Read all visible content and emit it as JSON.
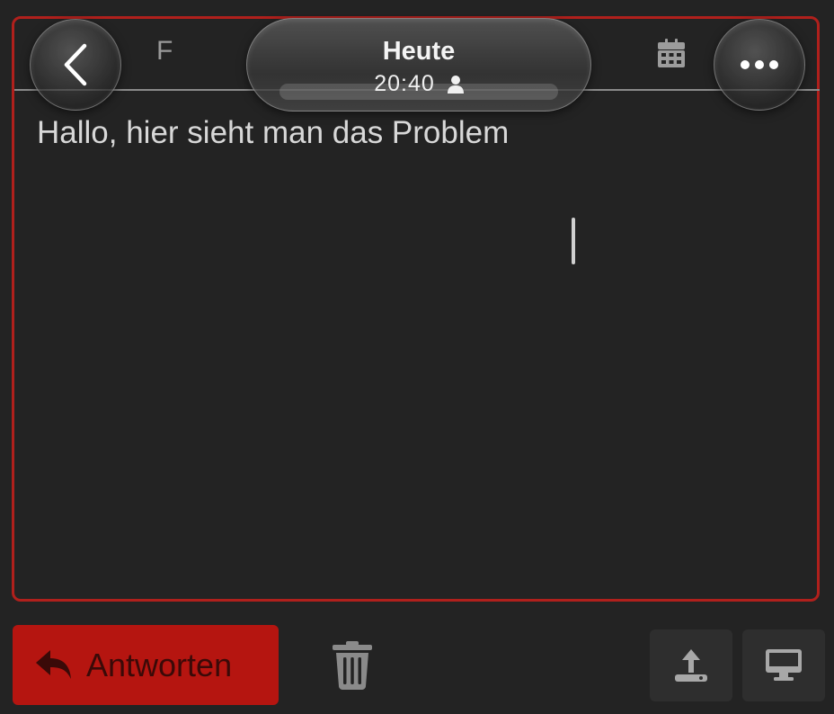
{
  "header": {
    "format_letter": "F",
    "title": "Heute",
    "time": "20:40",
    "back_icon": "chevron-left-icon",
    "calendar_icon": "calendar-icon",
    "more_icon": "ellipsis-icon",
    "person_icon": "person-icon"
  },
  "editor": {
    "text": "Hallo, hier sieht man das Problem",
    "border_color": "#b0201c"
  },
  "footer": {
    "reply_label": "Antworten",
    "reply_icon": "reply-arrow-icon",
    "reply_color": "#b51510",
    "trash_icon": "trash-icon",
    "upload_icon": "upload-icon",
    "display_icon": "monitor-icon"
  }
}
